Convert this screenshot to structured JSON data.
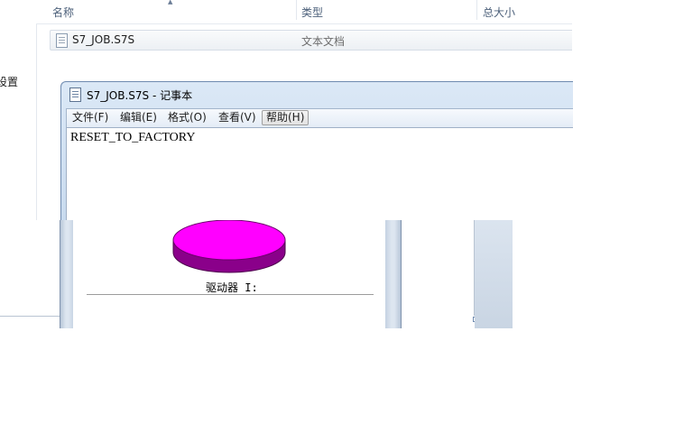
{
  "explorer": {
    "nav_item_partial": "设置",
    "columns": {
      "name": "名称",
      "type": "类型",
      "size": "总大小"
    },
    "file": {
      "name": "S7_JOB.S7S",
      "type": "文本文档"
    }
  },
  "notepad": {
    "title": "S7_JOB.S7S - 记事本",
    "menus": [
      "文件(F)",
      "编辑(E)",
      "格式(O)",
      "查看(V)",
      "帮助(H)"
    ],
    "active_menu": "帮助(H)",
    "content": "RESET_TO_FACTORY"
  },
  "drive_panel": {
    "label": "驱动器 I:",
    "disk_color": "#ff00ff",
    "disk_side_color": "#8a008a"
  }
}
